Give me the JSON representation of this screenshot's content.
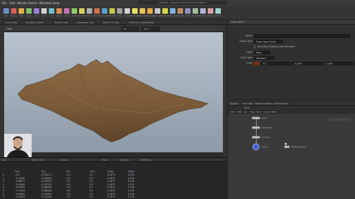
{
  "menubar": {
    "items": [
      "File",
      "Edit",
      "Render",
      "Assets",
      "Windows",
      "Help"
    ],
    "window_title": "Untitled - Houdini FX Education Edition"
  },
  "shelf": {
    "tools": [
      {
        "label": "Box",
        "color": "#6b8fc9"
      },
      {
        "label": "Sphere",
        "color": "#d85c5c"
      },
      {
        "label": "Tube",
        "color": "#e0b04a"
      },
      {
        "label": "Torus",
        "color": "#7fbf6a"
      },
      {
        "label": "Grid",
        "color": "#9b7fd1"
      },
      {
        "label": "Null",
        "color": "#cfcfcf"
      },
      {
        "label": "Line",
        "color": "#6bbfc9"
      },
      {
        "label": "Circle",
        "color": "#d88b4f"
      },
      {
        "label": "Curve",
        "color": "#c26fb0"
      },
      {
        "label": "Path",
        "color": "#8fc96b"
      },
      {
        "label": "Spray Paint",
        "color": "#d9d05a"
      },
      {
        "label": "Font",
        "color": "#b0b0b0"
      },
      {
        "label": "Platonic",
        "color": "#d0704a"
      },
      {
        "label": "L-System",
        "color": "#5a9fd0"
      },
      {
        "label": "Metaball",
        "color": "#c9c94a"
      },
      {
        "label": "File",
        "color": "#a0a0a0"
      },
      {
        "label": "Camera",
        "color": "#d0d0d0"
      },
      {
        "label": "Point Light",
        "color": "#e8e06a"
      },
      {
        "label": "Spot Light",
        "color": "#e8c45a"
      },
      {
        "label": "Area Light",
        "color": "#e8a84a"
      },
      {
        "label": "Geo Light",
        "color": "#c8c8c8"
      },
      {
        "label": "Distant",
        "color": "#d8d84a"
      },
      {
        "label": "Sky Light",
        "color": "#7fb0e0"
      },
      {
        "label": "GI Light",
        "color": "#c09060"
      },
      {
        "label": "Portal",
        "color": "#9090c0"
      },
      {
        "label": "Ambient",
        "color": "#a0c0a0"
      },
      {
        "label": "Switcher",
        "color": "#b0b0d0"
      },
      {
        "label": "Stereo",
        "color": "#d0a0a0"
      },
      {
        "label": "VR Cam",
        "color": "#a0d0d0"
      }
    ]
  },
  "tabs": [
    "Scene View",
    "Animation Editor",
    "Render View",
    "Composite View",
    "Motion FX View",
    "Geometry Spreadsheet"
  ],
  "viewport": {
    "label": "Color",
    "toolbar_fields": [
      "obj",
      "geo1"
    ],
    "terrain_color": "#7a5a3a"
  },
  "params": {
    "header": "Color  color1",
    "rows": [
      {
        "label": "Name",
        "value": ""
      },
      {
        "label": "Group Type",
        "value": "Guess from Group"
      },
      {
        "label": "",
        "value": "Normalize Existing Color Attribute"
      },
      {
        "label": "Class",
        "value": "Point"
      },
      {
        "label": "Color Type",
        "value": "Constant"
      },
      {
        "label": "Color",
        "value": "0.5"
      }
    ],
    "color_values": [
      "0.5",
      "0.1873",
      "0.076"
    ]
  },
  "network": {
    "tabs": [
      "/obj/geo1",
      "Tree View",
      "Material Palette",
      "Asset Browser"
    ],
    "path": "geo1",
    "menu": [
      "Add",
      "Edit",
      "Go",
      "View",
      "Tools",
      "Layout",
      "Help"
    ],
    "context_label": "Geometry",
    "nodes": [
      {
        "name": "grid1"
      },
      {
        "name": "mountain1"
      },
      {
        "name": "normal1"
      },
      {
        "name": "color1"
      },
      {
        "name": "attribwrangle1"
      }
    ]
  },
  "spreadsheet": {
    "toolbar": [
      "geo1",
      "Node: color1",
      "Group:",
      "View",
      "Intrinsics",
      "Attributes:"
    ],
    "columns": [
      "",
      "P[x]",
      "P[y]",
      "P[z]",
      "Cd[r]",
      "Cd[g]",
      "Cd[b]"
    ],
    "rows": [
      [
        "0",
        "-5.0",
        "0.176271",
        "-5.0",
        "0.5",
        "0.1873",
        "0.076"
      ],
      [
        "1",
        "-4.74484",
        "0.240845",
        "-5.0",
        "0.5",
        "0.1873",
        "0.076"
      ],
      [
        "2",
        "-4.48977",
        "0.292095",
        "-5.0",
        "0.5",
        "0.1873",
        "0.076"
      ],
      [
        "3",
        "-4.23469",
        "0.325117",
        "-5.0",
        "0.5",
        "0.1873",
        "0.076"
      ],
      [
        "4",
        "-3.97961",
        "0.298756",
        "-5.0",
        "0.5",
        "0.1873",
        "0.076"
      ],
      [
        "5",
        "-3.72453",
        "0.188264",
        "-5.0",
        "0.5",
        "0.1873",
        "0.076"
      ],
      [
        "6",
        "-3.46945",
        "0.126501",
        "-5.0",
        "0.5",
        "0.1873",
        "0.076"
      ],
      [
        "7",
        "-3.21437",
        "0.132006",
        "-5.0",
        "0.5",
        "0.1873",
        "0.076"
      ]
    ]
  }
}
